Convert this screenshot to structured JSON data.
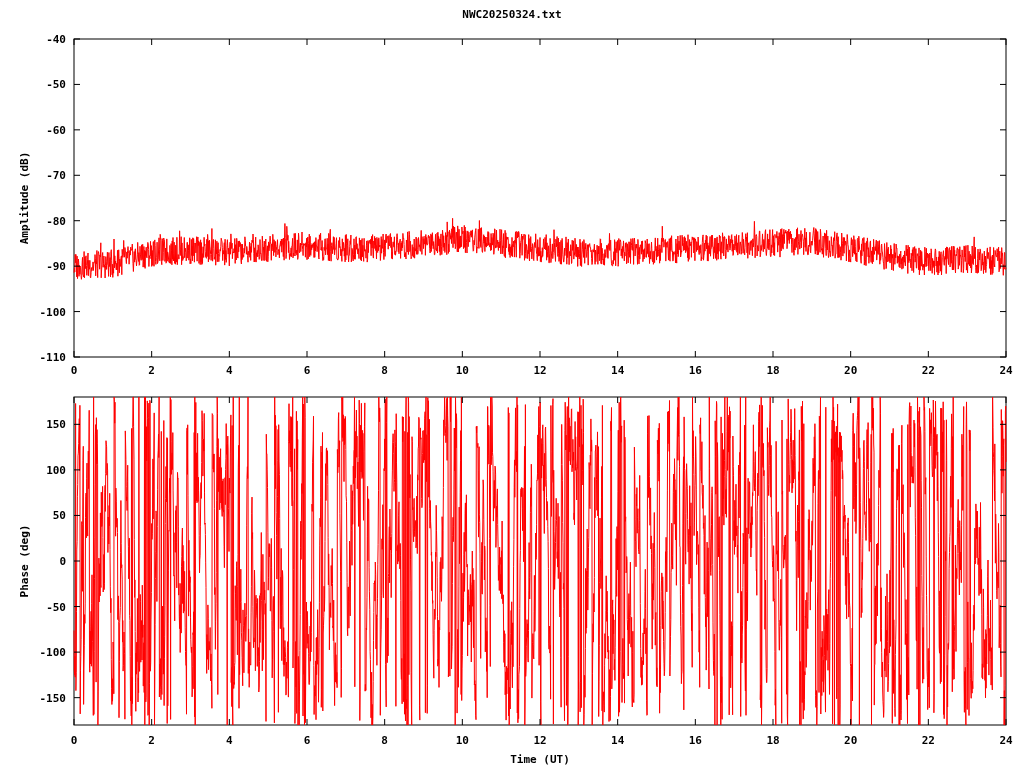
{
  "title": "NWC20250324.txt",
  "panels": [
    {
      "kind": "amplitude",
      "ylabel": "Amplitude (dB)",
      "xticks": [
        "0",
        "2",
        "4",
        "6",
        "8",
        "10",
        "12",
        "14",
        "16",
        "18",
        "20",
        "22",
        "24"
      ],
      "yticks": [
        "-40",
        "-50",
        "-60",
        "-70",
        "-80",
        "-90",
        "-100",
        "-110"
      ]
    },
    {
      "kind": "phase",
      "ylabel": "Phase (deg)",
      "xlabel": "Time (UT)",
      "xticks": [
        "0",
        "2",
        "4",
        "6",
        "8",
        "10",
        "12",
        "14",
        "16",
        "18",
        "20",
        "22",
        "24"
      ],
      "yticks": [
        "150",
        "100",
        "50",
        "0",
        "-50",
        "-100",
        "-150"
      ]
    }
  ]
}
